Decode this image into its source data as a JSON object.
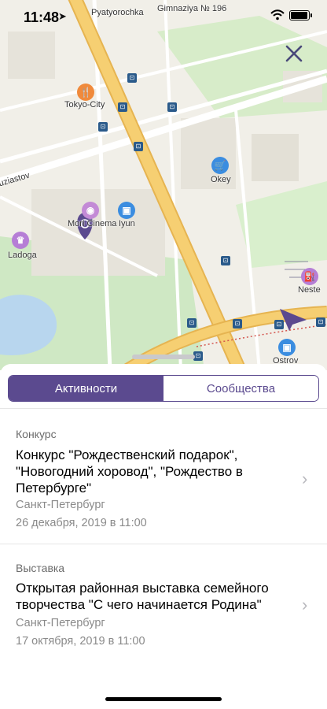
{
  "status_bar": {
    "time": "11:48"
  },
  "map": {
    "labels": {
      "pyatyorochka": "Pyatyorochka",
      "gimnaziya": "Gimnaziya № 196",
      "tokyo_city": "Tokyo-City",
      "okey": "Okey",
      "street": "uziastov",
      "mori_cinema": "Mori Cinema",
      "iyun": "Iyun",
      "ladoga": "Ladoga",
      "neste": "Neste",
      "ostrov": "Ostrov"
    },
    "colors": {
      "road_major": "#f4c96a",
      "road_minor": "#ffffff",
      "park": "#cfe8c4",
      "water": "#b8d6ee",
      "block": "#ecebe4",
      "pin": "#5b4a8f"
    }
  },
  "tabs": [
    {
      "label": "Активности",
      "active": true
    },
    {
      "label": "Сообщества",
      "active": false
    }
  ],
  "events": [
    {
      "category": "Конкурс",
      "title": "Конкурс \"Рождественский подарок\", \"Новогодний хоровод\", \"Рождество в Петербурге\"",
      "city": "Санкт-Петербург",
      "date": "26 декабря, 2019 в 11:00"
    },
    {
      "category": "Выставка",
      "title": "Открытая районная выставка семейного творчества \"С чего начинается Родина\"",
      "city": "Санкт-Петербург",
      "date": "17 октября, 2019 в 11:00"
    }
  ]
}
